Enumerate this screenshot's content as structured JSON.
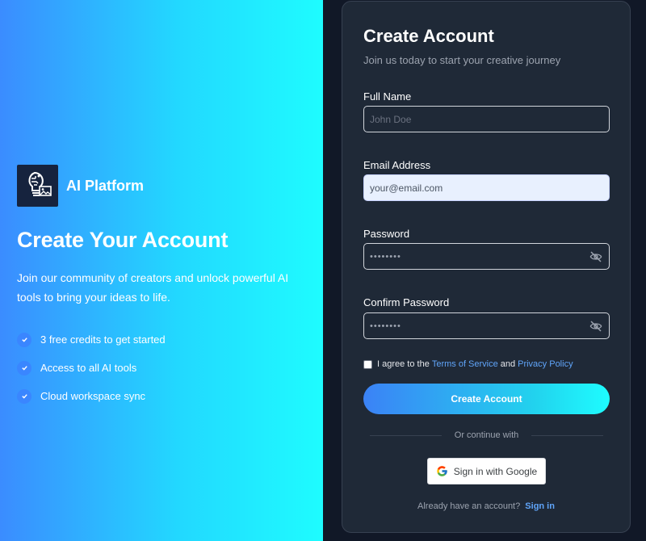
{
  "brand": {
    "name": "AI Platform",
    "logo_icon": "brain-lightbulb-image-icon"
  },
  "hero": {
    "title": "Create Your Account",
    "description": "Join our community of creators and unlock powerful AI tools to bring your ideas to life.",
    "features": [
      {
        "label": "3 free credits to get started",
        "icon": "check-icon"
      },
      {
        "label": "Access to all AI tools",
        "icon": "check-icon"
      },
      {
        "label": "Cloud workspace sync",
        "icon": "check-icon"
      }
    ]
  },
  "form": {
    "title": "Create Account",
    "subtitle": "Join us today to start your creative journey",
    "full_name": {
      "label": "Full Name",
      "placeholder": "John Doe",
      "value": ""
    },
    "email": {
      "label": "Email Address",
      "placeholder": "your@email.com",
      "value": ""
    },
    "password": {
      "label": "Password",
      "masked_value": "••••••••",
      "toggle_icon": "eye-off-icon"
    },
    "confirm_password": {
      "label": "Confirm Password",
      "masked_value": "••••••••",
      "toggle_icon": "eye-off-icon"
    },
    "agree": {
      "prefix": "I agree to the",
      "terms": "Terms of Service",
      "and": "and",
      "privacy": "Privacy Policy",
      "checked": false
    },
    "submit_label": "Create Account",
    "divider_text": "Or continue with",
    "google_label": "Sign in with Google",
    "signin_prompt": "Already have an account?",
    "signin_link": "Sign in"
  },
  "colors": {
    "accent_blue": "#3b82f6",
    "accent_cyan": "#1efcff",
    "card_bg": "#1f2937",
    "page_bg": "#111827",
    "link": "#60a5fa"
  }
}
